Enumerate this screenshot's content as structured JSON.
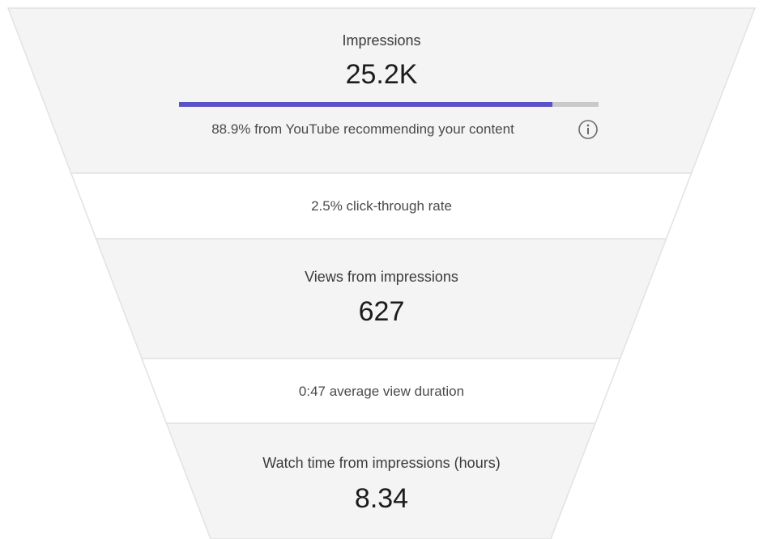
{
  "funnel": {
    "impressions": {
      "label": "Impressions",
      "value": "25.2K",
      "recommendation_share": 0.889,
      "recommendation_text": "88.9% from YouTube recommending your content",
      "info_icon": "info-icon"
    },
    "ctr": {
      "text": "2.5% click-through rate"
    },
    "views": {
      "label": "Views from impressions",
      "value": "627"
    },
    "avg_duration": {
      "text": "0:47 average view duration"
    },
    "watch_time": {
      "label": "Watch time from impressions (hours)",
      "value": "8.34"
    }
  },
  "colors": {
    "band_shaded": "#f4f4f4",
    "band_light": "#ffffff",
    "divider": "#e2e2e2",
    "bar_fill": "#5c52c7",
    "bar_track": "#c9c9c9"
  }
}
